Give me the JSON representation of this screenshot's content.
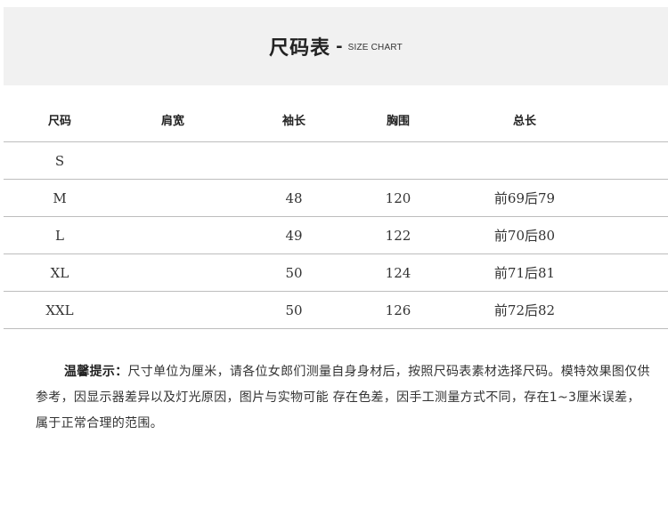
{
  "header": {
    "title": "尺码表",
    "dash": "-",
    "subtitle": "SIZE CHART"
  },
  "table": {
    "columns": [
      "尺码",
      "肩宽",
      "袖长",
      "胸围",
      "总长"
    ],
    "rows": [
      {
        "size": "S",
        "shoulder": "",
        "sleeve": "",
        "chest": "",
        "length": ""
      },
      {
        "size": "M",
        "shoulder": "",
        "sleeve": "48",
        "chest": "120",
        "length": "前69后79"
      },
      {
        "size": "L",
        "shoulder": "",
        "sleeve": "49",
        "chest": "122",
        "length": "前70后80"
      },
      {
        "size": "XL",
        "shoulder": "",
        "sleeve": "50",
        "chest": "124",
        "length": "前71后81"
      },
      {
        "size": "XXL",
        "shoulder": "",
        "sleeve": "50",
        "chest": "126",
        "length": "前72后82"
      }
    ]
  },
  "notice": {
    "label": "温馨提示：",
    "text": "尺寸单位为厘米，请各位女郎们测量自身身材后，按照尺码表素材选择尺码。模特效果图仅供参考，因显示器差异以及灯光原因，图片与实物可能 存在色差，因手工测量方式不同，存在1~3厘米误差，属于正常合理的范围。"
  }
}
